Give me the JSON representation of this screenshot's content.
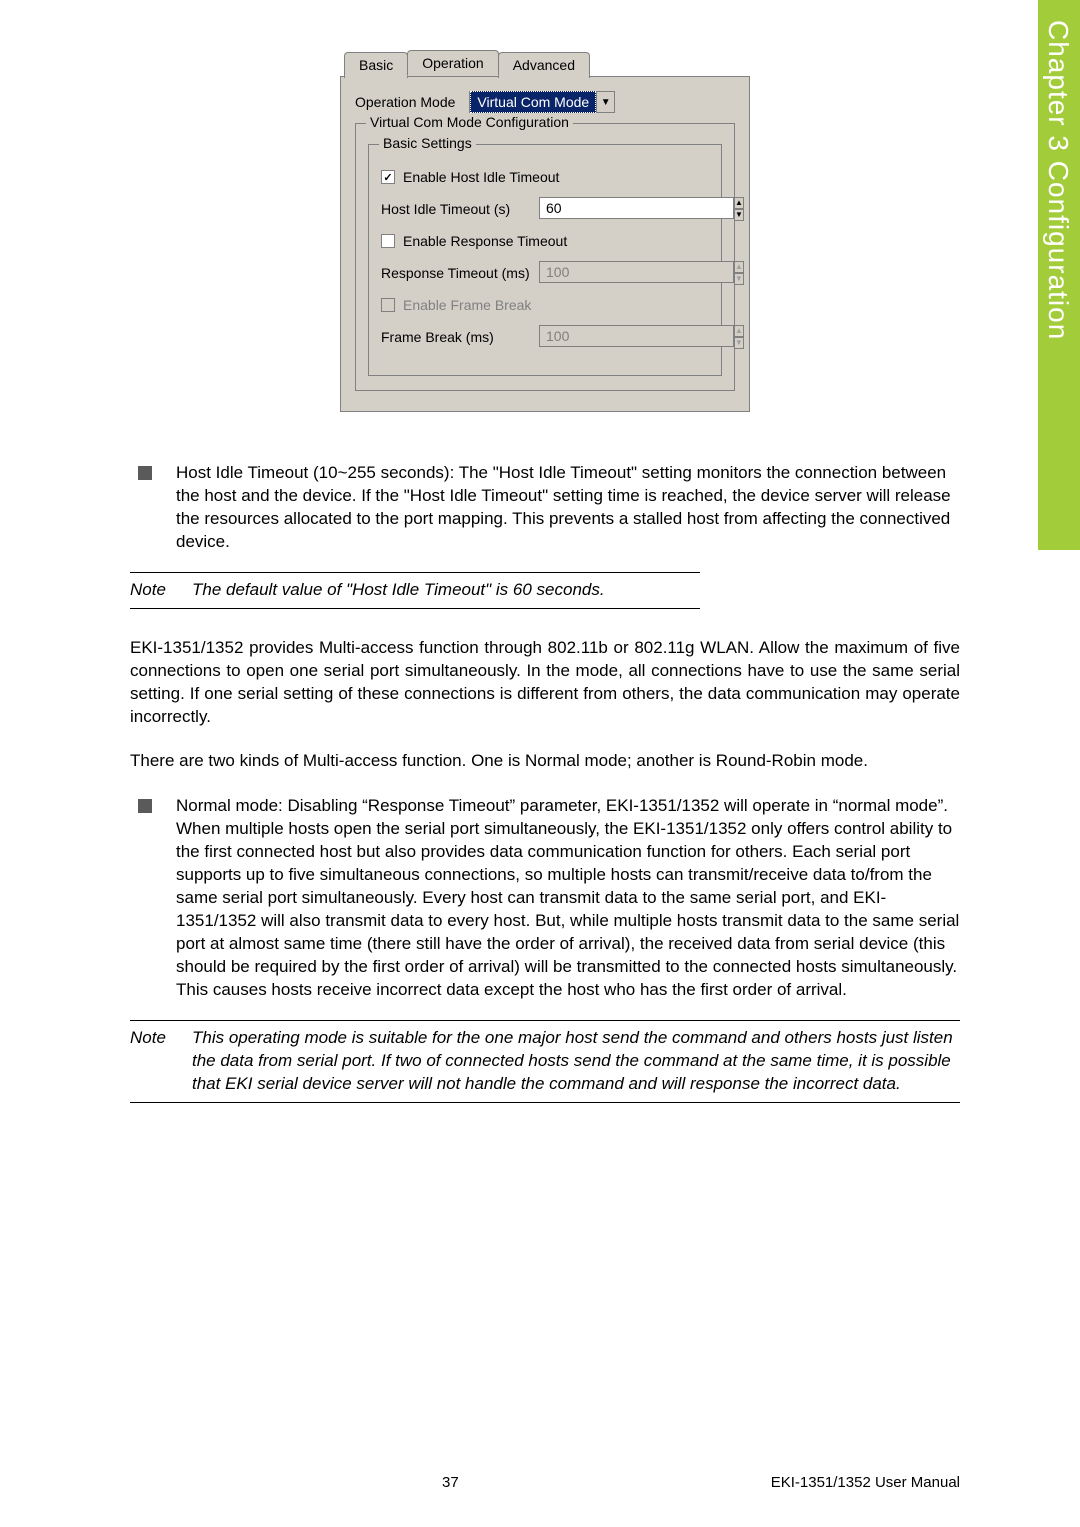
{
  "sideTab": "Chapter 3  Configuration",
  "dialog": {
    "tabs": {
      "basic": "Basic",
      "operation": "Operation",
      "advanced": "Advanced"
    },
    "opModeLabel": "Operation Mode",
    "opModeValue": "Virtual Com Mode",
    "fieldset1": "Virtual Com Mode Configuration",
    "fieldset2": "Basic Settings",
    "chkHostIdle": "Enable Host Idle Timeout",
    "hostIdleLabel": "Host Idle Timeout (s)",
    "hostIdleValue": "60",
    "chkResponse": "Enable Response Timeout",
    "responseLabel": "Response Timeout (ms)",
    "responseValue": "100",
    "chkFrame": "Enable Frame Break",
    "frameLabel": "Frame Break (ms)",
    "frameValue": "100"
  },
  "bullet1": "Host Idle Timeout (10~255 seconds): The \"Host Idle Timeout\" setting monitors the connection between the host and the device. If the \"Host Idle Timeout\" setting time is reached, the device server will release the resources allocated to the port mapping. This prevents a stalled host from affecting the connectived device.",
  "note1Label": "Note",
  "note1": "The default value of \"Host Idle Timeout\" is 60 seconds.",
  "para1": "EKI-1351/1352 provides Multi-access function through 802.11b or 802.11g WLAN. Allow the maximum of five connections to open one serial port simultaneously. In the mode, all connections have to use the same serial setting. If one serial setting of these connections is different from others, the data communication may operate incorrectly.",
  "para2": "There are two kinds of Multi-access function. One is Normal mode; another is Round-Robin mode.",
  "bullet2": "Normal mode: Disabling “Response Timeout” parameter, EKI-1351/1352 will operate in “normal mode”. When multiple hosts open the serial port simultaneously, the EKI-1351/1352 only offers control ability to the first connected host but also provides data communication function for others. Each serial port supports up to five simultaneous connections, so multiple hosts can transmit/receive data to/from the same serial port simultaneously. Every host can transmit data to the same serial port, and EKI-1351/1352 will also transmit data to every host. But, while multiple hosts transmit data to the same serial port at almost same time (there still have the order of arrival), the received data from serial device (this should be required by the first order of arrival) will be transmitted to the connected hosts simultaneously. This causes hosts receive incorrect data except the host who has the first order of arrival.",
  "note2Label": "Note",
  "note2": "This operating mode is suitable for the one major host send the command and others hosts just listen the data from serial port. If two of connected hosts send the command at the same time, it is possible that EKI serial device server will not handle the command and will response the incorrect data.",
  "footer": {
    "page": "37",
    "manual": "EKI-1351/1352 User Manual"
  }
}
